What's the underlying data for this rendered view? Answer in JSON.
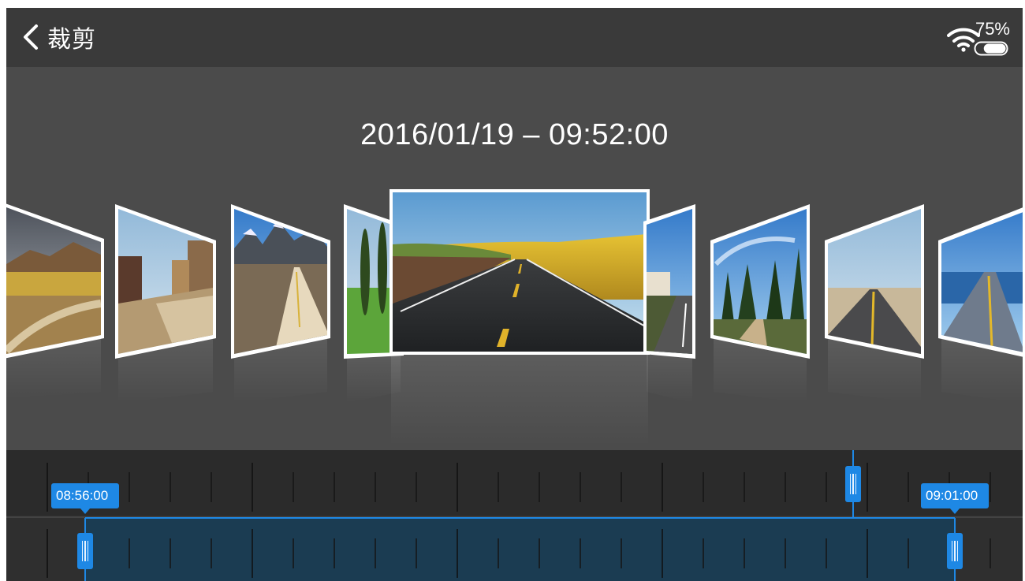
{
  "header": {
    "back_label": "back",
    "title": "裁剪"
  },
  "status": {
    "wifi_icon": "wifi-icon",
    "battery_icon": "battery-icon",
    "battery_percent": "75%",
    "battery_level": 0.75
  },
  "viewer": {
    "datetime": "2016/01/19 – 09:52:00"
  },
  "thumbnails": [
    {
      "name": "thumb-mountain-field",
      "scene": "mountain meadow with dirt path",
      "selected": false
    },
    {
      "name": "thumb-town-street",
      "scene": "old town street",
      "selected": false
    },
    {
      "name": "thumb-mountain-road",
      "scene": "road toward rocky peaks",
      "selected": false
    },
    {
      "name": "thumb-cypress-trees",
      "scene": "cypress trees in green field",
      "selected": false
    },
    {
      "name": "thumb-open-road",
      "scene": "asphalt road through golden fields",
      "selected": true
    },
    {
      "name": "thumb-town-road",
      "scene": "road past houses",
      "selected": false
    },
    {
      "name": "thumb-forest-road",
      "scene": "forest path under blue sky",
      "selected": false
    },
    {
      "name": "thumb-desert-highway",
      "scene": "desert highway",
      "selected": false
    },
    {
      "name": "thumb-bridge-road",
      "scene": "bridge road over sea",
      "selected": false
    }
  ],
  "timeline": {
    "start_label": "08:56:00",
    "end_label": "09:01:00",
    "accent": "#1e88e5"
  },
  "colors": {
    "background": "#4b4b4b",
    "header": "#3a3a3a",
    "timeline": "#2d2d2d",
    "accent": "#1e88e5"
  }
}
